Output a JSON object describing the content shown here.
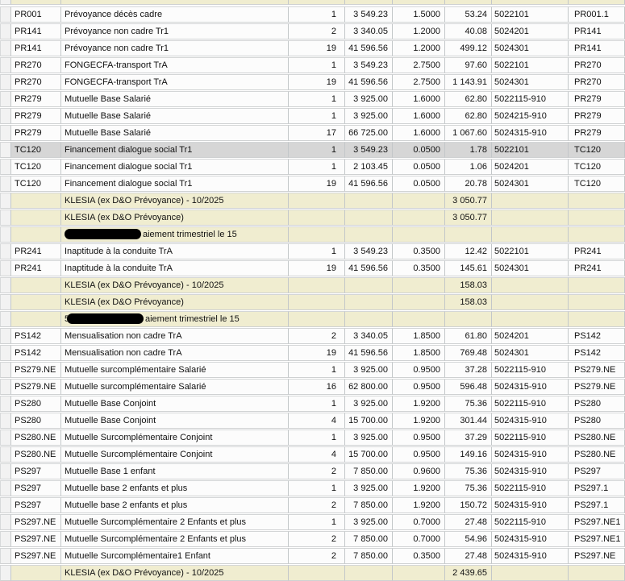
{
  "colors": {
    "group_row_bg": "#f0edd0",
    "selected_row_bg": "#d6d6d6",
    "row_bg": "#fcfcfc",
    "grid_border": "#c3c7c9"
  },
  "table": {
    "rows": [
      {
        "t": "item",
        "code": "PR001",
        "label": "Prévoyance décès cadre",
        "count": "1",
        "base": "3 549.23",
        "rate": "1.5000",
        "amount": "53.24",
        "account": "5022101",
        "ref": "PR001.1"
      },
      {
        "t": "item",
        "code": "PR141",
        "label": "Prévoyance non cadre Tr1",
        "count": "2",
        "base": "3 340.05",
        "rate": "1.2000",
        "amount": "40.08",
        "account": "5024201",
        "ref": "PR141"
      },
      {
        "t": "item",
        "code": "PR141",
        "label": "Prévoyance non cadre Tr1",
        "count": "19",
        "base": "41 596.56",
        "rate": "1.2000",
        "amount": "499.12",
        "account": "5024301",
        "ref": "PR141"
      },
      {
        "t": "item",
        "code": "PR270",
        "label": "FONGECFA-transport TrA",
        "count": "1",
        "base": "3 549.23",
        "rate": "2.7500",
        "amount": "97.60",
        "account": "5022101",
        "ref": "PR270"
      },
      {
        "t": "item",
        "code": "PR270",
        "label": "FONGECFA-transport TrA",
        "count": "19",
        "base": "41 596.56",
        "rate": "2.7500",
        "amount": "1 143.91",
        "account": "5024301",
        "ref": "PR270"
      },
      {
        "t": "item",
        "code": "PR279",
        "label": "Mutuelle Base Salarié",
        "count": "1",
        "base": "3 925.00",
        "rate": "1.6000",
        "amount": "62.80",
        "account": "5022115-910",
        "ref": "PR279"
      },
      {
        "t": "item",
        "code": "PR279",
        "label": "Mutuelle Base Salarié",
        "count": "1",
        "base": "3 925.00",
        "rate": "1.6000",
        "amount": "62.80",
        "account": "5024215-910",
        "ref": "PR279"
      },
      {
        "t": "item",
        "code": "PR279",
        "label": "Mutuelle Base Salarié",
        "count": "17",
        "base": "66 725.00",
        "rate": "1.6000",
        "amount": "1 067.60",
        "account": "5024315-910",
        "ref": "PR279"
      },
      {
        "t": "selected",
        "code": "TC120",
        "label": "Financement dialogue social Tr1",
        "count": "1",
        "base": "3 549.23",
        "rate": "0.0500",
        "amount": "1.78",
        "account": "5022101",
        "ref": "TC120"
      },
      {
        "t": "item",
        "code": "TC120",
        "label": "Financement dialogue social Tr1",
        "count": "1",
        "base": "2 103.45",
        "rate": "0.0500",
        "amount": "1.06",
        "account": "5024201",
        "ref": "TC120"
      },
      {
        "t": "item",
        "code": "TC120",
        "label": "Financement dialogue social Tr1",
        "count": "19",
        "base": "41 596.56",
        "rate": "0.0500",
        "amount": "20.78",
        "account": "5024301",
        "ref": "TC120"
      },
      {
        "t": "summary",
        "label": "KLESIA (ex D&O Prévoyance)  - 10/2025",
        "amount": "3 050.77"
      },
      {
        "t": "summary",
        "label": "KLESIA (ex D&O Prévoyance)",
        "amount": "3 050.77"
      },
      {
        "t": "note",
        "frag": "",
        "note": "aiement trimestriel le 15"
      },
      {
        "t": "item",
        "code": "PR241",
        "label": "Inaptitude à la conduite TrA",
        "count": "1",
        "base": "3 549.23",
        "rate": "0.3500",
        "amount": "12.42",
        "account": "5022101",
        "ref": "PR241"
      },
      {
        "t": "item",
        "code": "PR241",
        "label": "Inaptitude à la conduite TrA",
        "count": "19",
        "base": "41 596.56",
        "rate": "0.3500",
        "amount": "145.61",
        "account": "5024301",
        "ref": "PR241"
      },
      {
        "t": "summary",
        "label": "KLESIA (ex D&O Prévoyance)  - 10/2025",
        "amount": "158.03"
      },
      {
        "t": "summary",
        "label": "KLESIA (ex D&O Prévoyance)",
        "amount": "158.03"
      },
      {
        "t": "note",
        "frag": "5",
        "note": "aiement trimestriel le 15"
      },
      {
        "t": "item",
        "code": "PS142",
        "label": "Mensualisation non cadre TrA",
        "count": "2",
        "base": "3 340.05",
        "rate": "1.8500",
        "amount": "61.80",
        "account": "5024201",
        "ref": "PS142"
      },
      {
        "t": "item",
        "code": "PS142",
        "label": "Mensualisation non cadre TrA",
        "count": "19",
        "base": "41 596.56",
        "rate": "1.8500",
        "amount": "769.48",
        "account": "5024301",
        "ref": "PS142"
      },
      {
        "t": "item",
        "code": "PS279.NE",
        "label": "Mutuelle surcomplémentaire Salarié",
        "count": "1",
        "base": "3 925.00",
        "rate": "0.9500",
        "amount": "37.28",
        "account": "5022115-910",
        "ref": "PS279.NE"
      },
      {
        "t": "item",
        "code": "PS279.NE",
        "label": "Mutuelle surcomplémentaire Salarié",
        "count": "16",
        "base": "62 800.00",
        "rate": "0.9500",
        "amount": "596.48",
        "account": "5024315-910",
        "ref": "PS279.NE"
      },
      {
        "t": "item",
        "code": "PS280",
        "label": "Mutuelle Base Conjoint",
        "count": "1",
        "base": "3 925.00",
        "rate": "1.9200",
        "amount": "75.36",
        "account": "5022115-910",
        "ref": "PS280"
      },
      {
        "t": "item",
        "code": "PS280",
        "label": "Mutuelle Base Conjoint",
        "count": "4",
        "base": "15 700.00",
        "rate": "1.9200",
        "amount": "301.44",
        "account": "5024315-910",
        "ref": "PS280"
      },
      {
        "t": "item",
        "code": "PS280.NE",
        "label": "Mutuelle Surcomplémentaire Conjoint",
        "count": "1",
        "base": "3 925.00",
        "rate": "0.9500",
        "amount": "37.29",
        "account": "5022115-910",
        "ref": "PS280.NE"
      },
      {
        "t": "item",
        "code": "PS280.NE",
        "label": "Mutuelle Surcomplémentaire Conjoint",
        "count": "4",
        "base": "15 700.00",
        "rate": "0.9500",
        "amount": "149.16",
        "account": "5024315-910",
        "ref": "PS280.NE"
      },
      {
        "t": "item",
        "code": "PS297",
        "label": "Mutuelle Base 1 enfant",
        "count": "2",
        "base": "7 850.00",
        "rate": "0.9600",
        "amount": "75.36",
        "account": "5024315-910",
        "ref": "PS297"
      },
      {
        "t": "item",
        "code": "PS297",
        "label": "Mutuelle base 2 enfants et plus",
        "count": "1",
        "base": "3 925.00",
        "rate": "1.9200",
        "amount": "75.36",
        "account": "5022115-910",
        "ref": "PS297.1"
      },
      {
        "t": "item",
        "code": "PS297",
        "label": "Mutuelle base 2 enfants et plus",
        "count": "2",
        "base": "7 850.00",
        "rate": "1.9200",
        "amount": "150.72",
        "account": "5024315-910",
        "ref": "PS297.1"
      },
      {
        "t": "item",
        "code": "PS297.NE",
        "label": "Mutuelle Surcomplémentaire 2 Enfants et plus",
        "count": "1",
        "base": "3 925.00",
        "rate": "0.7000",
        "amount": "27.48",
        "account": "5022115-910",
        "ref": "PS297.NE1"
      },
      {
        "t": "item",
        "code": "PS297.NE",
        "label": "Mutuelle Surcomplémentaire 2 Enfants et plus",
        "count": "2",
        "base": "7 850.00",
        "rate": "0.7000",
        "amount": "54.96",
        "account": "5024315-910",
        "ref": "PS297.NE1"
      },
      {
        "t": "item",
        "code": "PS297.NE",
        "label": "Mutuelle Surcomplémentaire1 Enfant",
        "count": "2",
        "base": "7 850.00",
        "rate": "0.3500",
        "amount": "27.48",
        "account": "5024315-910",
        "ref": "PS297.NE"
      },
      {
        "t": "summary",
        "label": "KLESIA (ex D&O Prévoyance)  - 10/2025",
        "amount": "2 439.65"
      }
    ]
  }
}
